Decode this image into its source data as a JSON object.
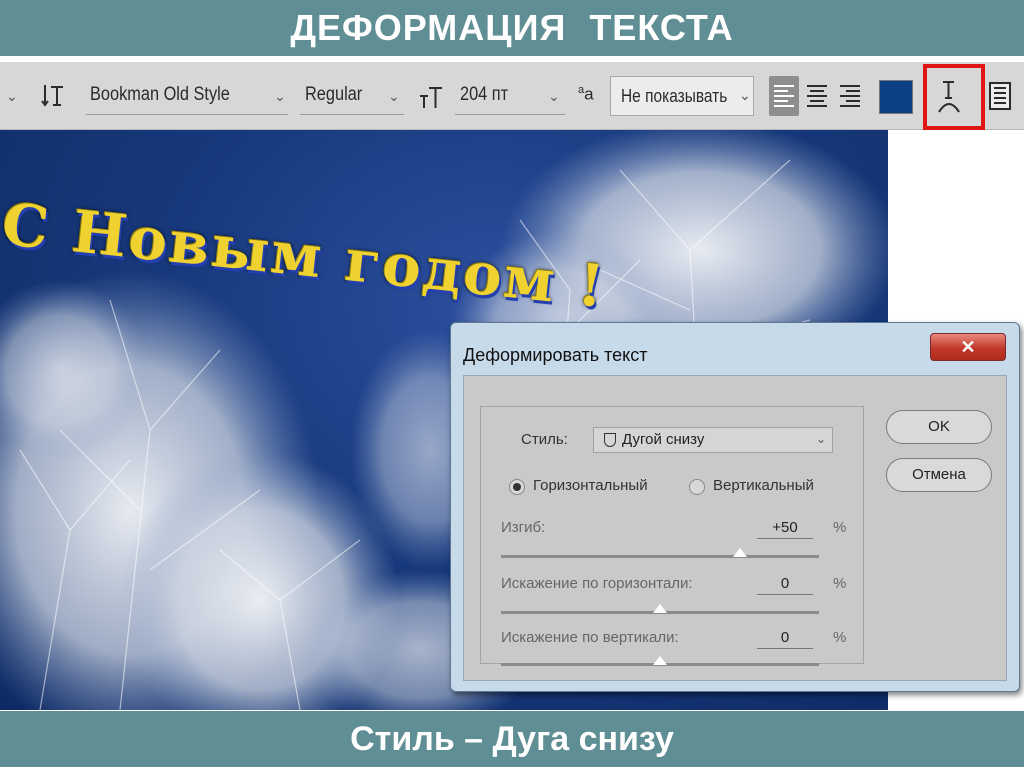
{
  "slide": {
    "title": "ДЕФОРМАЦИЯ ТЕКСТА",
    "caption": "Стиль – Дуга снизу"
  },
  "options_bar": {
    "font_family": "Bookman Old Style",
    "font_style": "Regular",
    "font_size": "204 пт",
    "antialias": "Не показывать",
    "text_color": "#0d3f85",
    "icons": [
      "text-orientation-icon",
      "font-size-icon",
      "antialias-icon",
      "align-left-icon",
      "align-center-icon",
      "align-right-icon",
      "warp-text-icon",
      "panels-icon"
    ]
  },
  "canvas": {
    "greeting": "С Новым годом !"
  },
  "dialog": {
    "title": "Деформировать текст",
    "close_label": "✕",
    "style_label": "Стиль:",
    "style_value": "Дугой снизу",
    "horizontal_label": "Горизонтальный",
    "vertical_label": "Вертикальный",
    "orientation_selected": "horizontal",
    "bend_label": "Изгиб:",
    "bend_value": "+50",
    "hdist_label": "Искажение по горизонтали:",
    "hdist_value": "0",
    "vdist_label": "Искажение по вертикали:",
    "vdist_value": "0",
    "percent": "%",
    "ok_label": "OK",
    "cancel_label": "Отмена"
  },
  "sliders": {
    "bend_percent": 50,
    "horizontal_distortion_percent": 0,
    "vertical_distortion_percent": 0
  }
}
